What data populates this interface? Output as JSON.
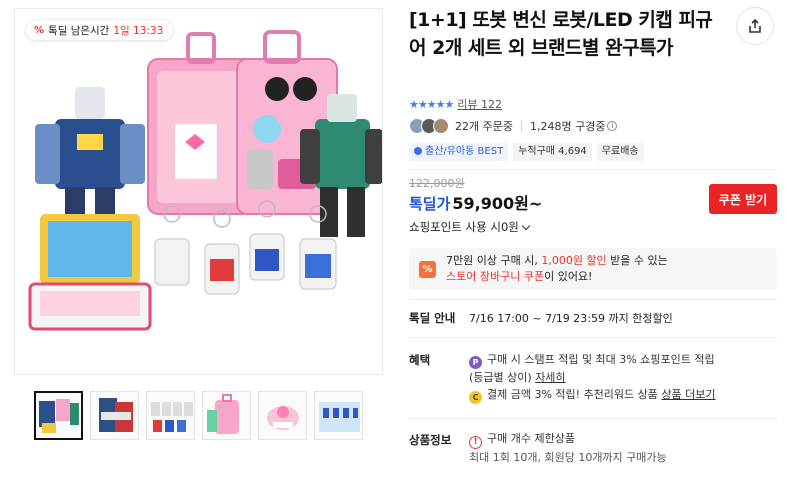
{
  "timer": {
    "label": "톡딜 남은시간",
    "remaining": "1일 13:33"
  },
  "thumbnails": [
    {
      "alt": "thumbnail-1"
    },
    {
      "alt": "thumbnail-2"
    },
    {
      "alt": "thumbnail-3"
    },
    {
      "alt": "thumbnail-4"
    },
    {
      "alt": "thumbnail-5"
    },
    {
      "alt": "thumbnail-6"
    }
  ],
  "product": {
    "title": "[1+1] 또봇 변신 로봇/LED 키캡 피규어 2개 세트 외 브랜드별 완구특가",
    "stars": "★★★★★",
    "review_text": "리뷰 122",
    "order_count": "22개 주문중",
    "subscriber_count": "1,248명 구경중",
    "info_symbol": "i",
    "tags": {
      "best": "출산/유아동 BEST",
      "cumulative": "누적구매 4,694",
      "shipping": "무료배송"
    }
  },
  "pricing": {
    "original": "122,000원",
    "deal_label": "톡딜가",
    "price": "59,900원~",
    "coupon_button": "쿠폰 받기",
    "points_text": "쇼핑포인트 사용 시0원"
  },
  "promo": {
    "icon_text": "%",
    "line1_a": "7만원 이상 구매 시, ",
    "line1_b": "1,000원 할인",
    "line1_c": " 받을 수 있는",
    "line2_a": "스토어 장바구니 쿠폰",
    "line2_b": "이 있어요!"
  },
  "deal_info": {
    "label": "톡딜 안내",
    "text": "7/16 17:00 ~ 7/19 23:59 까지 한정할인"
  },
  "benefits": {
    "label": "혜택",
    "item1_icon": "P",
    "item1_line1": "구매 시 스탬프 적립 및 최대 3% 쇼핑포인트 적립",
    "item1_line2_a": "(등급별 상이) ",
    "item1_link": "자세히",
    "item2_icon": "C",
    "item2_text": "결제 금액 3% 적립! 추천리워드 상품 ",
    "item2_link": "상품 더보기"
  },
  "product_info": {
    "label": "상품정보",
    "alert_symbol": "!",
    "limit_title": "구매 개수 제한상품",
    "limit_detail": "최대 1회 10개, 회원당 10개까지 구매가능"
  },
  "colors": {
    "accent_blue": "#1f53d6",
    "coupon_red": "#eb2323",
    "promo_orange": "#f4713b"
  }
}
